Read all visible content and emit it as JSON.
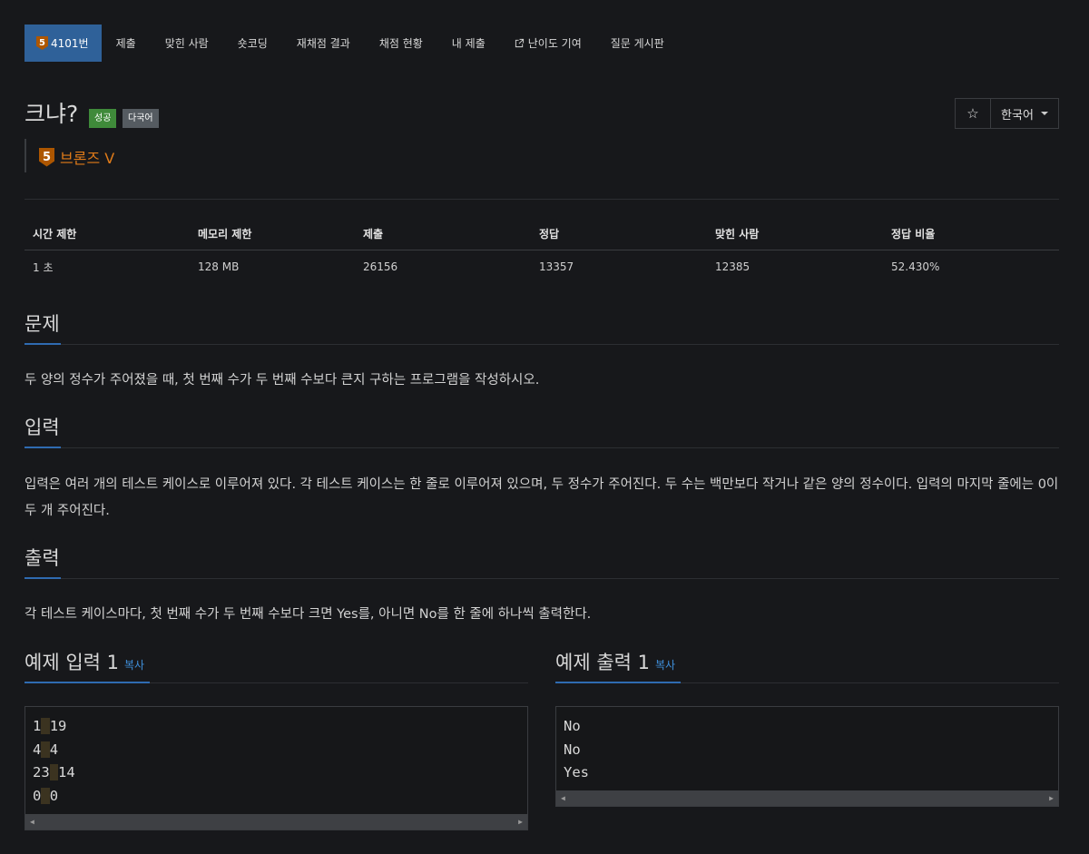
{
  "nav": {
    "items": [
      {
        "label": "4101번",
        "tier": "5"
      },
      {
        "label": "제출"
      },
      {
        "label": "맞힌 사람"
      },
      {
        "label": "숏코딩"
      },
      {
        "label": "재채점 결과"
      },
      {
        "label": "채점 현황"
      },
      {
        "label": "내 제출"
      },
      {
        "label": "난이도 기여"
      },
      {
        "label": "질문 게시판"
      }
    ]
  },
  "problem": {
    "title": "크냐?",
    "badges": {
      "result": "성공",
      "multilang": "다국어"
    },
    "tier_number": "5",
    "tier_label": "브론즈 V",
    "tier_color": "#ad5600"
  },
  "toolbar": {
    "star": "☆",
    "language": "한국어"
  },
  "info": {
    "headers": [
      "시간 제한",
      "메모리 제한",
      "제출",
      "정답",
      "맞힌 사람",
      "정답 비율"
    ],
    "values": [
      "1 초",
      "128 MB",
      "26156",
      "13357",
      "12385",
      "52.430%"
    ]
  },
  "sections": {
    "problem": {
      "title": "문제",
      "text": "두 양의 정수가 주어졌을 때, 첫 번째 수가 두 번째 수보다 큰지 구하는 프로그램을 작성하시오."
    },
    "input": {
      "title": "입력",
      "text": "입력은 여러 개의 테스트 케이스로 이루어져 있다. 각 테스트 케이스는 한 줄로 이루어져 있으며, 두 정수가 주어진다. 두 수는 백만보다 작거나 같은 양의 정수이다. 입력의 마지막 줄에는 0이 두 개 주어진다."
    },
    "output": {
      "title": "출력",
      "text": "각 테스트 케이스마다, 첫 번째 수가 두 번째 수보다 크면 Yes를, 아니면 No를 한 줄에 하나씩 출력한다."
    }
  },
  "samples": {
    "input": {
      "title": "예제 입력 1",
      "copy": "복사",
      "lines": [
        [
          "1",
          "19"
        ],
        [
          "4",
          "4"
        ],
        [
          "23",
          "14"
        ],
        [
          "0",
          "0"
        ]
      ]
    },
    "output": {
      "title": "예제 출력 1",
      "copy": "복사",
      "lines": [
        "No",
        "No",
        "Yes"
      ]
    }
  },
  "colors": {
    "accent": "#2f6199",
    "success": "#3f8a3a",
    "tier_bronze": "#e07b19",
    "link": "#3f8fdb"
  }
}
